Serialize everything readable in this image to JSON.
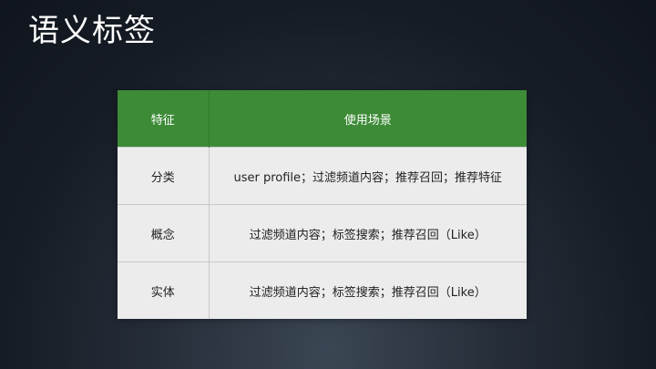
{
  "slide": {
    "title": "语义标签"
  },
  "table": {
    "headers": [
      "特征",
      "使用场景"
    ],
    "rows": [
      {
        "feature": "分类",
        "usage": "user profile；过滤频道内容；推荐召回；推荐特征"
      },
      {
        "feature": "概念",
        "usage": "过滤频道内容；标签搜索；推荐召回（Like）"
      },
      {
        "feature": "实体",
        "usage": "过滤频道内容；标签搜索；推荐召回（Like）"
      }
    ]
  },
  "colors": {
    "header_bg": "#3d8b37",
    "row_bg": "#ececec"
  }
}
